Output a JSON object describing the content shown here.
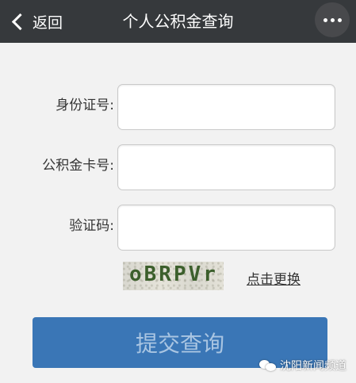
{
  "header": {
    "back_label": "返回",
    "title": "个人公积金查询",
    "more_icon": "more-dots-icon"
  },
  "form": {
    "id_label": "身份证号:",
    "id_value": "",
    "card_label": "公积金卡号:",
    "card_value": "",
    "code_label": "验证码:",
    "code_value": ""
  },
  "captcha": {
    "text": "oBRPVr",
    "refresh_label": "点击更换"
  },
  "submit_label": "提交查询",
  "watermark": {
    "text": "沈阳新闻频道",
    "icon": "wechat-icon"
  },
  "colors": {
    "header_bg": "#36393c",
    "button_bg": "#3a76b6",
    "button_text": "#a9c5e2",
    "page_bg": "#f2f2f2"
  }
}
